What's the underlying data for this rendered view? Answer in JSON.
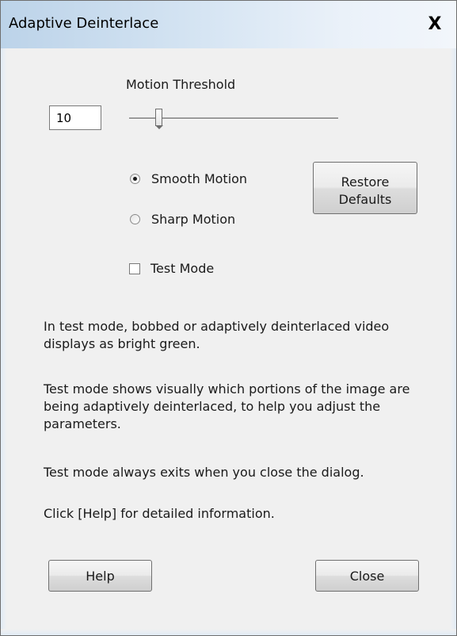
{
  "window": {
    "title": "Adaptive Deinterlace",
    "close_glyph": "X"
  },
  "motion": {
    "label": "Motion Threshold",
    "value": "10",
    "slider_fraction": 0.14
  },
  "options": {
    "smooth_label": "Smooth Motion",
    "sharp_label": "Sharp Motion",
    "selected": "smooth",
    "test_mode_label": "Test Mode",
    "test_mode_checked": false
  },
  "buttons": {
    "restore_line1": "Restore",
    "restore_line2": "Defaults",
    "help": "Help",
    "close": "Close"
  },
  "info": {
    "p1": "In test mode, bobbed or adaptively deinterlaced video displays as bright green.",
    "p2": "Test mode shows visually which portions of the image are being adaptively deinterlaced, to help you adjust the parameters.",
    "p3": "Test mode always exits when you close the dialog.",
    "p4": "Click [Help] for detailed information."
  },
  "icons": {
    "close": "close-icon",
    "radio": "radio-icon",
    "checkbox": "checkbox-icon"
  },
  "colors": {
    "titlebar_start": "#bcd3e9",
    "dialog_bg": "#f0f0f0"
  }
}
